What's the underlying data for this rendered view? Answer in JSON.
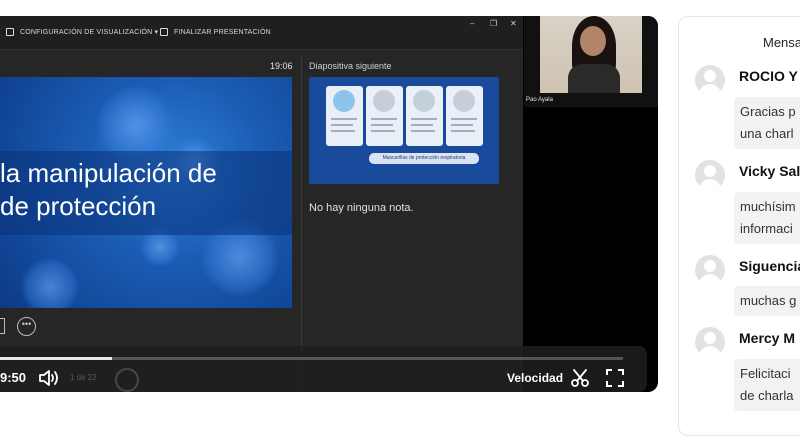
{
  "presenter_view": {
    "toolbar": {
      "display_settings": "CONFIGURACIÓN DE VISUALIZACIÓN ▾",
      "end_show": "FINALIZAR PRESENTACIÓN"
    },
    "timer": "19:06",
    "next_slide_label": "Diapositiva siguiente",
    "current_slide": {
      "title_line1": "la manipulación de",
      "title_line2": "de protección"
    },
    "next_slide_thumbnail": {
      "banner": "Mascarillas de protección respiratoria"
    },
    "notes": "No hay ninguna nota.",
    "webcam_name": "Pao Ayala"
  },
  "player_controls": {
    "current_time": "9:50",
    "slide_counter": "1 de 22",
    "speed_label": "Velocidad",
    "progress_fraction": 0.18
  },
  "chat": {
    "header": "Mensa",
    "messages": [
      {
        "author": "ROCIO Y",
        "lines": [
          "Gracias p",
          "una charl"
        ]
      },
      {
        "author": "Vicky Sal",
        "lines": [
          "muchísim",
          "informaci"
        ]
      },
      {
        "author": "Siguencia",
        "lines": [
          "muchas g"
        ]
      },
      {
        "author": "Mercy M",
        "lines": [
          "Felicitaci",
          "de charla"
        ]
      }
    ]
  },
  "icons": [
    "volume-icon",
    "scissors-icon",
    "fullscreen-icon",
    "more-options-icon",
    "avatar-icon"
  ]
}
